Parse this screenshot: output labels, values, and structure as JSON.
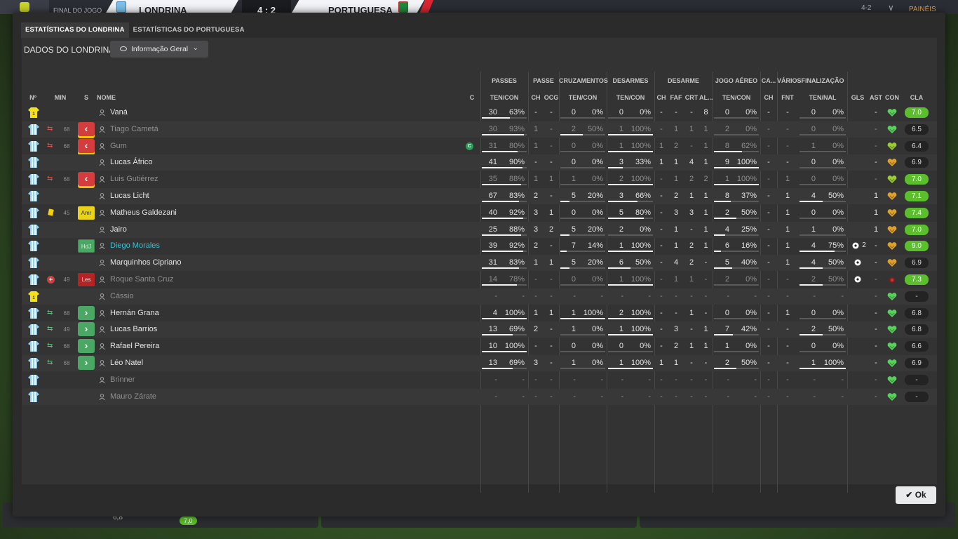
{
  "scoreboard": {
    "status": "FINAL DO JOGO",
    "home": "LONDRINA",
    "score": "4 : 2",
    "away": "PORTUGUESA",
    "right_score": "4-2",
    "right_label": "PAINÉIS"
  },
  "tabs": [
    {
      "label": "ESTATÍSTICAS DO LONDRINA",
      "active": true
    },
    {
      "label": "ESTATÍSTICAS DO PORTUGUESA",
      "active": false
    }
  ],
  "header": {
    "title": "DADOS DO LONDRINA",
    "dropdown": "Informação Geral"
  },
  "groups": [
    {
      "label": "PASSES",
      "key": "g_pass"
    },
    {
      "label": "PASSE",
      "key": "g_passe"
    },
    {
      "label": "CRUZAMENTOS",
      "key": "g_cruz"
    },
    {
      "label": "DESARMES",
      "key": "g_des"
    },
    {
      "label": "DESARME",
      "key": "g_desarme"
    },
    {
      "label": "JOGO AÉREO",
      "key": "g_aereo"
    },
    {
      "label": "CA...",
      "key": "g_ca"
    },
    {
      "label": "VÁRIOS",
      "key": "g_var"
    },
    {
      "label": "FINALIZAÇÃO",
      "key": "g_fin"
    }
  ],
  "columns": {
    "num": "Nº",
    "min": "MIN",
    "s": "S",
    "name": "NOME",
    "c": "C",
    "pass": "TEN/CON",
    "ch": "CH",
    "ocg": "OCG",
    "cruz": "TEN/CON",
    "des": "TEN/CON",
    "d_ch": "CH",
    "faf": "FAF",
    "crt": "CRT",
    "al": "AL...",
    "aereo": "TEN/CON",
    "ca_ch": "CH",
    "fnt": "FNT",
    "fin": "TEN/NAL",
    "gls": "GLS",
    "ast": "AST",
    "con": "CON",
    "cla": "CLA"
  },
  "players": [
    {
      "shirt": "gk",
      "name": "Vaná",
      "min": "",
      "sub": "",
      "badge": "",
      "cap": false,
      "pass": [
        "30",
        "63%"
      ],
      "pass_pct": 63,
      "ch": "-",
      "ocg": "-",
      "cruz": [
        "0",
        "0%"
      ],
      "cruz_pct": 0,
      "des": [
        "0",
        "0%"
      ],
      "des_pct": 0,
      "d_ch": "-",
      "faf": "-",
      "crt": "-",
      "al": "8",
      "aereo": [
        "0",
        "0%"
      ],
      "aereo_pct": 0,
      "ca_ch": "-",
      "fnt": "-",
      "fin": [
        "0",
        "0%"
      ],
      "fin_pct": 0,
      "gls": "",
      "ast": "-",
      "con": "green",
      "rating": "7.0",
      "rgood": true,
      "faded": false
    },
    {
      "shirt": "field",
      "name": "Tiago Cametá",
      "min": "68",
      "sub": "out",
      "badge": "",
      "cap": false,
      "pass": [
        "30",
        "93%"
      ],
      "pass_pct": 93,
      "ch": "1",
      "ocg": "-",
      "cruz": [
        "2",
        "50%"
      ],
      "cruz_pct": 50,
      "des": [
        "1",
        "100%"
      ],
      "des_pct": 100,
      "d_ch": "-",
      "faf": "1",
      "crt": "1",
      "al": "1",
      "aereo": [
        "2",
        "0%"
      ],
      "aereo_pct": 0,
      "ca_ch": "-",
      "fnt": "-",
      "fin": [
        "0",
        "0%"
      ],
      "fin_pct": 0,
      "gls": "",
      "ast": "-",
      "con": "green",
      "rating": "6.5",
      "rgood": false,
      "faded": true
    },
    {
      "shirt": "field",
      "name": "Gum",
      "min": "68",
      "sub": "out",
      "badge": "",
      "cap": true,
      "pass": [
        "31",
        "80%"
      ],
      "pass_pct": 80,
      "ch": "1",
      "ocg": "-",
      "cruz": [
        "0",
        "0%"
      ],
      "cruz_pct": 0,
      "des": [
        "1",
        "100%"
      ],
      "des_pct": 100,
      "d_ch": "1",
      "faf": "2",
      "crt": "-",
      "al": "1",
      "aereo": [
        "8",
        "62%"
      ],
      "aereo_pct": 62,
      "ca_ch": "-",
      "fnt": "-",
      "fin": [
        "1",
        "0%"
      ],
      "fin_pct": 0,
      "gls": "",
      "ast": "-",
      "con": "lime",
      "rating": "6.4",
      "rgood": false,
      "faded": true
    },
    {
      "shirt": "field",
      "name": "Lucas Áfrico",
      "min": "",
      "sub": "",
      "badge": "",
      "cap": false,
      "pass": [
        "41",
        "90%"
      ],
      "pass_pct": 90,
      "ch": "-",
      "ocg": "-",
      "cruz": [
        "0",
        "0%"
      ],
      "cruz_pct": 0,
      "des": [
        "3",
        "33%"
      ],
      "des_pct": 33,
      "d_ch": "1",
      "faf": "1",
      "crt": "4",
      "al": "1",
      "aereo": [
        "9",
        "100%"
      ],
      "aereo_pct": 100,
      "ca_ch": "-",
      "fnt": "-",
      "fin": [
        "0",
        "0%"
      ],
      "fin_pct": 0,
      "gls": "",
      "ast": "-",
      "con": "orange",
      "rating": "6.9",
      "rgood": false,
      "faded": false
    },
    {
      "shirt": "field",
      "name": "Luis Gutiérrez",
      "min": "68",
      "sub": "out",
      "badge": "",
      "cap": false,
      "pass": [
        "35",
        "88%"
      ],
      "pass_pct": 88,
      "ch": "1",
      "ocg": "1",
      "cruz": [
        "1",
        "0%"
      ],
      "cruz_pct": 0,
      "des": [
        "2",
        "100%"
      ],
      "des_pct": 100,
      "d_ch": "-",
      "faf": "1",
      "crt": "2",
      "al": "2",
      "aereo": [
        "1",
        "100%"
      ],
      "aereo_pct": 100,
      "ca_ch": "-",
      "fnt": "1",
      "fin": [
        "0",
        "0%"
      ],
      "fin_pct": 0,
      "gls": "",
      "ast": "-",
      "con": "lime",
      "rating": "7.0",
      "rgood": true,
      "faded": true
    },
    {
      "shirt": "field",
      "name": "Lucas Licht",
      "min": "",
      "sub": "",
      "badge": "",
      "cap": false,
      "pass": [
        "67",
        "83%"
      ],
      "pass_pct": 83,
      "ch": "2",
      "ocg": "-",
      "cruz": [
        "5",
        "20%"
      ],
      "cruz_pct": 20,
      "des": [
        "3",
        "66%"
      ],
      "des_pct": 66,
      "d_ch": "-",
      "faf": "2",
      "crt": "1",
      "al": "1",
      "aereo": [
        "8",
        "37%"
      ],
      "aereo_pct": 37,
      "ca_ch": "-",
      "fnt": "1",
      "fin": [
        "4",
        "50%"
      ],
      "fin_pct": 50,
      "gls": "",
      "ast": "1",
      "con": "orange",
      "rating": "7.1",
      "rgood": true,
      "faded": false
    },
    {
      "shirt": "field",
      "name": "Matheus Galdezani",
      "min": "45",
      "sub": "yellow",
      "badge": "Amr",
      "cap": false,
      "pass": [
        "40",
        "92%"
      ],
      "pass_pct": 92,
      "ch": "3",
      "ocg": "1",
      "cruz": [
        "0",
        "0%"
      ],
      "cruz_pct": 0,
      "des": [
        "5",
        "80%"
      ],
      "des_pct": 80,
      "d_ch": "-",
      "faf": "3",
      "crt": "3",
      "al": "1",
      "aereo": [
        "2",
        "50%"
      ],
      "aereo_pct": 50,
      "ca_ch": "-",
      "fnt": "1",
      "fin": [
        "0",
        "0%"
      ],
      "fin_pct": 0,
      "gls": "",
      "ast": "1",
      "con": "orange",
      "rating": "7.4",
      "rgood": true,
      "faded": false
    },
    {
      "shirt": "field",
      "name": "Jairo",
      "min": "",
      "sub": "",
      "badge": "",
      "cap": false,
      "pass": [
        "25",
        "88%"
      ],
      "pass_pct": 88,
      "ch": "3",
      "ocg": "2",
      "cruz": [
        "5",
        "20%"
      ],
      "cruz_pct": 20,
      "des": [
        "2",
        "0%"
      ],
      "des_pct": 0,
      "d_ch": "-",
      "faf": "1",
      "crt": "-",
      "al": "1",
      "aereo": [
        "4",
        "25%"
      ],
      "aereo_pct": 25,
      "ca_ch": "-",
      "fnt": "1",
      "fin": [
        "1",
        "0%"
      ],
      "fin_pct": 0,
      "gls": "",
      "ast": "1",
      "con": "orange",
      "rating": "7.0",
      "rgood": true,
      "faded": false
    },
    {
      "shirt": "field",
      "name": "Diego Morales",
      "min": "",
      "sub": "",
      "badge": "HdJ",
      "cap": false,
      "pass": [
        "39",
        "92%"
      ],
      "pass_pct": 92,
      "ch": "2",
      "ocg": "-",
      "cruz": [
        "7",
        "14%"
      ],
      "cruz_pct": 14,
      "des": [
        "1",
        "100%"
      ],
      "des_pct": 100,
      "d_ch": "-",
      "faf": "1",
      "crt": "2",
      "al": "1",
      "aereo": [
        "6",
        "16%"
      ],
      "aereo_pct": 16,
      "ca_ch": "-",
      "fnt": "1",
      "fin": [
        "4",
        "75%"
      ],
      "fin_pct": 75,
      "gls": "2",
      "ast": "-",
      "con": "orange",
      "rating": "9.0",
      "rgood": true,
      "faded": false,
      "highlight": true
    },
    {
      "shirt": "field",
      "name": "Marquinhos Cipriano",
      "min": "",
      "sub": "",
      "badge": "",
      "cap": false,
      "pass": [
        "31",
        "83%"
      ],
      "pass_pct": 83,
      "ch": "1",
      "ocg": "1",
      "cruz": [
        "5",
        "20%"
      ],
      "cruz_pct": 20,
      "des": [
        "6",
        "50%"
      ],
      "des_pct": 50,
      "d_ch": "-",
      "faf": "4",
      "crt": "2",
      "al": "-",
      "aereo": [
        "5",
        "40%"
      ],
      "aereo_pct": 40,
      "ca_ch": "-",
      "fnt": "1",
      "fin": [
        "4",
        "50%"
      ],
      "fin_pct": 50,
      "gls": "ball",
      "ast": "-",
      "con": "orange",
      "rating": "6.9",
      "rgood": false,
      "faded": false
    },
    {
      "shirt": "field",
      "name": "Roque Santa Cruz",
      "min": "49",
      "sub": "injury",
      "badge": "Les",
      "cap": false,
      "pass": [
        "14",
        "78%"
      ],
      "pass_pct": 78,
      "ch": "-",
      "ocg": "-",
      "cruz": [
        "0",
        "0%"
      ],
      "cruz_pct": 0,
      "des": [
        "1",
        "100%"
      ],
      "des_pct": 100,
      "d_ch": "-",
      "faf": "1",
      "crt": "1",
      "al": "-",
      "aereo": [
        "2",
        "0%"
      ],
      "aereo_pct": 0,
      "ca_ch": "-",
      "fnt": "-",
      "fin": [
        "2",
        "50%"
      ],
      "fin_pct": 50,
      "gls": "ball",
      "ast": "-",
      "con": "red",
      "rating": "7.3",
      "rgood": true,
      "faded": true
    },
    {
      "shirt": "gk",
      "name": "Cássio",
      "min": "",
      "sub": "",
      "badge": "",
      "cap": false,
      "pass": [
        "-",
        "-"
      ],
      "pass_pct": -1,
      "ch": "-",
      "ocg": "-",
      "cruz": [
        "-",
        "-"
      ],
      "cruz_pct": -1,
      "des": [
        "-",
        "-"
      ],
      "des_pct": -1,
      "d_ch": "-",
      "faf": "-",
      "crt": "-",
      "al": "-",
      "aereo": [
        "-",
        "-"
      ],
      "aereo_pct": -1,
      "ca_ch": "-",
      "fnt": "-",
      "fin": [
        "-",
        "-"
      ],
      "fin_pct": -1,
      "gls": "",
      "ast": "-",
      "con": "green",
      "rating": "-",
      "rgood": false,
      "faded": true
    },
    {
      "shirt": "field",
      "name": "Hernán Grana",
      "min": "68",
      "sub": "in",
      "badge": "",
      "cap": false,
      "pass": [
        "4",
        "100%"
      ],
      "pass_pct": 100,
      "ch": "1",
      "ocg": "1",
      "cruz": [
        "1",
        "100%"
      ],
      "cruz_pct": 100,
      "des": [
        "2",
        "100%"
      ],
      "des_pct": 100,
      "d_ch": "-",
      "faf": "-",
      "crt": "1",
      "al": "-",
      "aereo": [
        "0",
        "0%"
      ],
      "aereo_pct": 0,
      "ca_ch": "-",
      "fnt": "1",
      "fin": [
        "0",
        "0%"
      ],
      "fin_pct": 0,
      "gls": "",
      "ast": "-",
      "con": "green",
      "rating": "6.8",
      "rgood": false,
      "faded": false
    },
    {
      "shirt": "field",
      "name": "Lucas Barrios",
      "min": "49",
      "sub": "in",
      "badge": "",
      "cap": false,
      "pass": [
        "13",
        "69%"
      ],
      "pass_pct": 69,
      "ch": "2",
      "ocg": "-",
      "cruz": [
        "1",
        "0%"
      ],
      "cruz_pct": 0,
      "des": [
        "1",
        "100%"
      ],
      "des_pct": 100,
      "d_ch": "-",
      "faf": "3",
      "crt": "-",
      "al": "1",
      "aereo": [
        "7",
        "42%"
      ],
      "aereo_pct": 42,
      "ca_ch": "-",
      "fnt": "-",
      "fin": [
        "2",
        "50%"
      ],
      "fin_pct": 50,
      "gls": "",
      "ast": "-",
      "con": "green",
      "rating": "6.8",
      "rgood": false,
      "faded": false
    },
    {
      "shirt": "field",
      "name": "Rafael Pereira",
      "min": "68",
      "sub": "in",
      "badge": "",
      "cap": false,
      "pass": [
        "10",
        "100%"
      ],
      "pass_pct": 100,
      "ch": "-",
      "ocg": "-",
      "cruz": [
        "0",
        "0%"
      ],
      "cruz_pct": 0,
      "des": [
        "0",
        "0%"
      ],
      "des_pct": 0,
      "d_ch": "-",
      "faf": "2",
      "crt": "1",
      "al": "1",
      "aereo": [
        "1",
        "0%"
      ],
      "aereo_pct": 0,
      "ca_ch": "-",
      "fnt": "-",
      "fin": [
        "0",
        "0%"
      ],
      "fin_pct": 0,
      "gls": "",
      "ast": "-",
      "con": "green",
      "rating": "6.6",
      "rgood": false,
      "faded": false
    },
    {
      "shirt": "field",
      "name": "Léo Natel",
      "min": "68",
      "sub": "in",
      "badge": "",
      "cap": false,
      "pass": [
        "13",
        "69%"
      ],
      "pass_pct": 69,
      "ch": "3",
      "ocg": "-",
      "cruz": [
        "1",
        "0%"
      ],
      "cruz_pct": 0,
      "des": [
        "1",
        "100%"
      ],
      "des_pct": 100,
      "d_ch": "1",
      "faf": "1",
      "crt": "-",
      "al": "-",
      "aereo": [
        "2",
        "50%"
      ],
      "aereo_pct": 50,
      "ca_ch": "-",
      "fnt": "-",
      "fin": [
        "1",
        "100%"
      ],
      "fin_pct": 100,
      "gls": "",
      "ast": "-",
      "con": "green",
      "rating": "6.9",
      "rgood": false,
      "faded": false
    },
    {
      "shirt": "field",
      "name": "Brinner",
      "min": "",
      "sub": "",
      "badge": "",
      "cap": false,
      "pass": [
        "-",
        "-"
      ],
      "pass_pct": -1,
      "ch": "-",
      "ocg": "-",
      "cruz": [
        "-",
        "-"
      ],
      "cruz_pct": -1,
      "des": [
        "-",
        "-"
      ],
      "des_pct": -1,
      "d_ch": "-",
      "faf": "-",
      "crt": "-",
      "al": "-",
      "aereo": [
        "-",
        "-"
      ],
      "aereo_pct": -1,
      "ca_ch": "-",
      "fnt": "-",
      "fin": [
        "-",
        "-"
      ],
      "fin_pct": -1,
      "gls": "",
      "ast": "-",
      "con": "green",
      "rating": "-",
      "rgood": false,
      "faded": true
    },
    {
      "shirt": "field",
      "name": "Mauro Zárate",
      "min": "",
      "sub": "",
      "badge": "",
      "cap": false,
      "pass": [
        "-",
        "-"
      ],
      "pass_pct": -1,
      "ch": "-",
      "ocg": "-",
      "cruz": [
        "-",
        "-"
      ],
      "cruz_pct": -1,
      "des": [
        "-",
        "-"
      ],
      "des_pct": -1,
      "d_ch": "-",
      "faf": "-",
      "crt": "-",
      "al": "-",
      "aereo": [
        "-",
        "-"
      ],
      "aereo_pct": -1,
      "ca_ch": "-",
      "fnt": "-",
      "fin": [
        "-",
        "-"
      ],
      "fin_pct": -1,
      "gls": "",
      "ast": "-",
      "con": "green",
      "rating": "-",
      "rgood": false,
      "faded": true
    }
  ],
  "footer": {
    "ok": "Ok",
    "bg_rating": "6,8",
    "bg_rating2": "7,0"
  },
  "colors": {
    "green": "#5bbf2d",
    "accent": "#3fbfd3",
    "red": "#d43d3d",
    "yellow": "#f2d300"
  }
}
